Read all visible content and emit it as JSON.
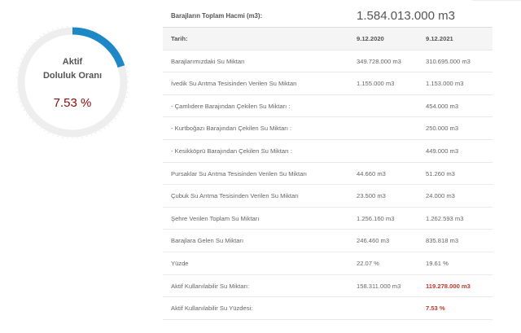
{
  "gauge": {
    "title_line1": "Aktif",
    "title_line2": "Doluluk Oranı",
    "value_text": "7.53 %",
    "fraction": 0.2,
    "track_color": "#eeeeee",
    "fill_color": "#1e88c7",
    "value_color": "#8b0a0a"
  },
  "table": {
    "header": {
      "label": "Barajların Toplam Hacmi (m3):",
      "total": "1.584.013.000 m3"
    },
    "date_row": {
      "label": "Tarih:",
      "col1": "9.12.2020",
      "col2": "9.12.2021"
    },
    "rows": [
      {
        "label": "Barajlarımızdaki Su Miktarı",
        "col1": "349.728.000 m3",
        "col2": "310.695.000 m3"
      },
      {
        "label": "İvedik Su Arıtma Tesisinden Verilen Su Miktarı",
        "col1": "1.155.000 m3",
        "col2": "1.153.000 m3"
      },
      {
        "label": "- Çamlıdere Barajından Çekilen Su Miktarı :",
        "col1": "",
        "col2": "454.000 m3"
      },
      {
        "label": "- Kurtboğazı Barajından Çekilen Su Miktarı :",
        "col1": "",
        "col2": "250.000 m3"
      },
      {
        "label": "- Kesikköprü Barajından Çekilen Su Miktarı :",
        "col1": "",
        "col2": "449.000 m3"
      },
      {
        "label": "Pursaklar Su Arıtma Tesisinden Verilen Su Miktarı",
        "col1": "44.660 m3",
        "col2": "51.260 m3"
      },
      {
        "label": "Çubuk Su Arıtma Tesisinden Verilen Su Miktarı",
        "col1": "23.500 m3",
        "col2": "24.000 m3"
      },
      {
        "label": "Şehre Verilen Toplam Su Miktarı",
        "col1": "1.256.160 m3",
        "col2": "1.262.593 m3"
      },
      {
        "label": "Barajlara Gelen Su Miktarı",
        "col1": "246.460 m3",
        "col2": "835.818 m3"
      },
      {
        "label": "Yüzde",
        "col1": "22.07 %",
        "col2": "19.61 %"
      },
      {
        "label": "Aktif Kullanılabilir Su Miktarı:",
        "col1": "158.311.000 m3",
        "col2": "119.278.000 m3"
      },
      {
        "label": "Aktif Kullanılabilir Su Yüzdesi:",
        "col1": "",
        "col2": "7.53 %"
      }
    ]
  }
}
